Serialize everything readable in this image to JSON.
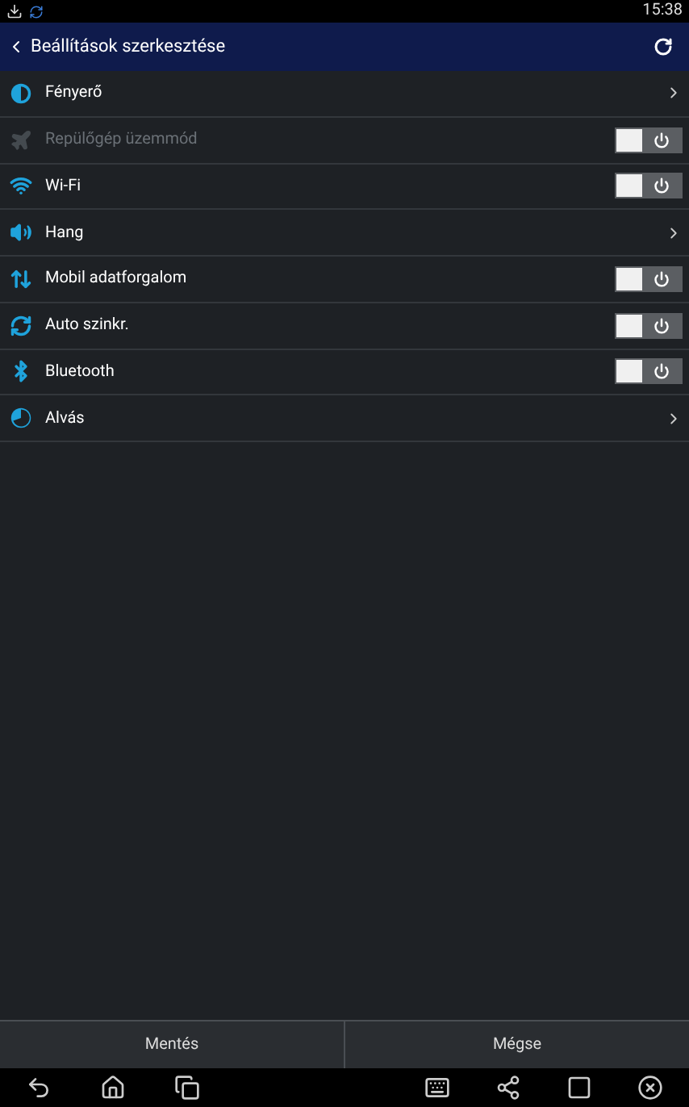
{
  "status_bar": {
    "time": "15:38"
  },
  "title_bar": {
    "title": "Beállítások szerkesztése"
  },
  "settings": [
    {
      "kind": "arrow",
      "label": "Fényerő",
      "disabled": false
    },
    {
      "kind": "toggle",
      "label": "Repülőgép üzemmód",
      "disabled": true,
      "on": false
    },
    {
      "kind": "toggle",
      "label": "Wi-Fi",
      "disabled": false,
      "on": false
    },
    {
      "kind": "arrow",
      "label": "Hang",
      "disabled": false
    },
    {
      "kind": "toggle",
      "label": "Mobil adatforgalom",
      "disabled": false,
      "on": false
    },
    {
      "kind": "toggle",
      "label": "Auto szinkr.",
      "disabled": false,
      "on": false
    },
    {
      "kind": "toggle",
      "label": "Bluetooth",
      "disabled": false,
      "on": false
    },
    {
      "kind": "arrow",
      "label": "Alvás",
      "disabled": false
    }
  ],
  "buttons": [
    "Mentés",
    "Mégse"
  ]
}
